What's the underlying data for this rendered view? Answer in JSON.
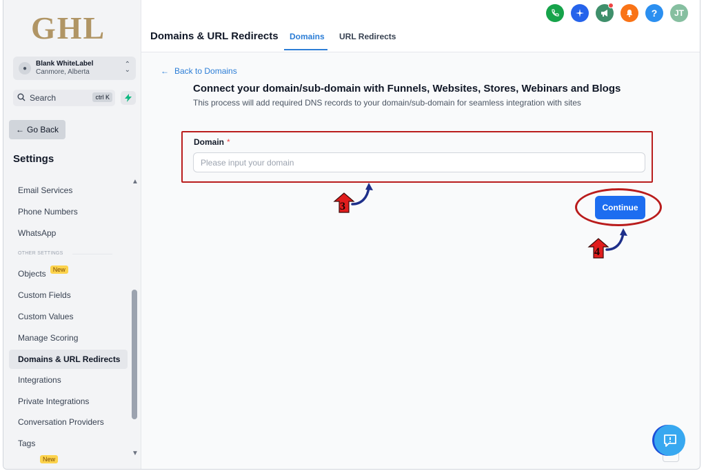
{
  "sidebar": {
    "logo": "GHL",
    "account": {
      "name": "Blank WhiteLabel",
      "location": "Canmore, Alberta"
    },
    "search": {
      "label": "Search",
      "shortcut": "ctrl K"
    },
    "go_back": "Go Back",
    "settings_title": "Settings",
    "items": [
      {
        "label": "Email Services"
      },
      {
        "label": "Phone Numbers"
      },
      {
        "label": "WhatsApp"
      },
      {
        "label": "Objects",
        "badge": "New"
      },
      {
        "label": "Custom Fields"
      },
      {
        "label": "Custom Values"
      },
      {
        "label": "Manage Scoring"
      },
      {
        "label": "Domains & URL Redirects"
      },
      {
        "label": "Integrations"
      },
      {
        "label": "Private Integrations"
      },
      {
        "label": "Conversation Providers"
      },
      {
        "label": "Tags"
      }
    ],
    "section_other": "OTHER SETTINGS",
    "labs_badge": "New"
  },
  "header": {
    "title": "Domains & URL Redirects",
    "tabs": [
      {
        "label": "Domains"
      },
      {
        "label": "URL Redirects"
      }
    ],
    "avatar_initials": "JT",
    "help_glyph": "?",
    "icons": [
      {
        "name": "phone-icon",
        "color": "#16a34a"
      },
      {
        "name": "sparkle-icon",
        "color": "#2563eb"
      },
      {
        "name": "megaphone-icon",
        "color": "#3f8f6b"
      },
      {
        "name": "bell-icon",
        "color": "#f97316"
      },
      {
        "name": "help-icon",
        "color": "#2b8ff0"
      },
      {
        "name": "avatar",
        "color": "#86bfa0"
      }
    ]
  },
  "main": {
    "back_link": "Back to Domains",
    "title": "Connect your domain/sub-domain with Funnels, Websites, Stores, Webinars and Blogs",
    "subtitle": "This process will add required DNS records to your domain/sub-domain for seamless integration with sites",
    "domain_label": "Domain",
    "domain_required": "*",
    "domain_placeholder": "Please input your domain",
    "domain_value": "",
    "continue_label": "Continue"
  },
  "annotations": {
    "step_3": "3",
    "step_4": "4",
    "highlight_color": "#b91c1c",
    "step_color": "#e11d1d",
    "arrow_color": "#1e2f8a"
  },
  "colors": {
    "accent": "#2b7dd6",
    "primary_button": "#1d6df0"
  }
}
